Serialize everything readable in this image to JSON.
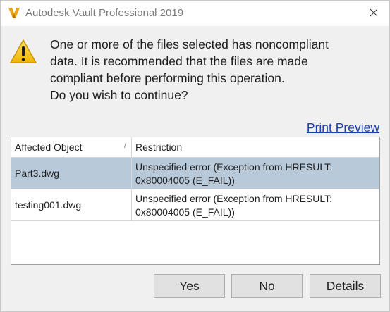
{
  "window": {
    "title": "Autodesk Vault Professional 2019"
  },
  "message": {
    "lines": [
      "One or more of the files selected has noncompliant",
      "data. It is recommended that the files are made",
      "compliant before performing this operation.",
      "Do you wish to continue?"
    ]
  },
  "links": {
    "print_preview": "Print Preview"
  },
  "table": {
    "columns": [
      "Affected Object",
      "Restriction"
    ],
    "sort_indicator": "/",
    "rows": [
      {
        "object": "Part3.dwg",
        "restriction": "Unspecified error (Exception from HRESULT: 0x80004005 (E_FAIL))",
        "selected": true
      },
      {
        "object": "testing001.dwg",
        "restriction": "Unspecified error (Exception from HRESULT: 0x80004005 (E_FAIL))",
        "selected": false
      }
    ]
  },
  "buttons": {
    "yes": "Yes",
    "no": "No",
    "details": "Details"
  },
  "icons": {
    "app": "autodesk-vault-icon",
    "warning": "warning-icon",
    "close": "close-icon"
  },
  "colors": {
    "selected_row": "#b8c9d9",
    "link": "#1c3fb0",
    "warning_fill": "#f5c518"
  }
}
